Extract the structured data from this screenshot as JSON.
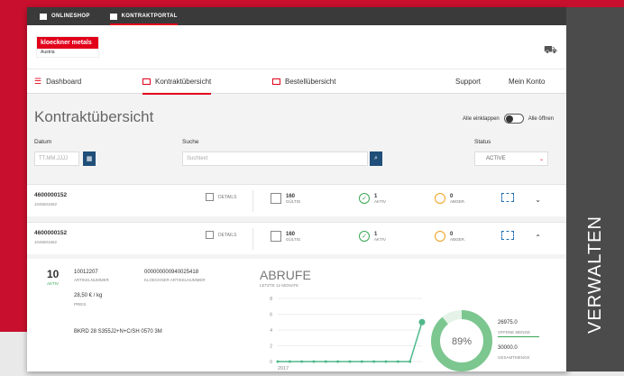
{
  "topbar": {
    "items": [
      {
        "label": "ONLINESHOP"
      },
      {
        "label": "KONTRAKTPORTAL"
      }
    ]
  },
  "header": {
    "logo_text": "kloeckner metals",
    "logo_sub": "Austria"
  },
  "nav": {
    "items": [
      {
        "label": "Dashboard"
      },
      {
        "label": "Kontraktübersicht"
      },
      {
        "label": "Bestellübersicht"
      },
      {
        "label": "Support"
      },
      {
        "label": "Mein Konto"
      }
    ]
  },
  "page": {
    "title": "Kontraktübersicht",
    "collapse_all": "Alle einklappen",
    "open_all": "Alle öffnen"
  },
  "filters": {
    "datum_label": "Datum",
    "datum_placeholder": "TT.MM.JJJJ",
    "suche_label": "Suche",
    "suche_placeholder": "Suchtext",
    "status_label": "Status",
    "status_value": "ACTIVE"
  },
  "contracts": [
    {
      "id": "4600000152",
      "sub": "1046601662",
      "details": "DETAILS",
      "gueltig_n": "160",
      "gueltig_t": "GÜLTIG",
      "aktiv_n": "1",
      "aktiv_t": "AKTIV",
      "abger_n": "0",
      "abger_t": "ABGER."
    },
    {
      "id": "4600000152",
      "sub": "1046601662",
      "details": "DETAILS",
      "gueltig_n": "160",
      "gueltig_t": "GÜLTIG",
      "aktiv_n": "1",
      "aktiv_t": "AKTIV",
      "abger_n": "0",
      "abger_t": "ABGER."
    }
  ],
  "detail": {
    "count": "10",
    "count_label": "AKTIV",
    "artikelnummer": "10012207",
    "artikelnummer_label": "ARTIKELNUMMER",
    "kloeckner_nr": "000000000940025418",
    "kloeckner_label": "KLOECKNER ARTIKELNUMMER",
    "preis": "28,50 € / kg",
    "preis_label": "PREIS",
    "description": "BKRD 28 S355J2+N+C/SH 0570 3M",
    "abrufe_title": "ABRUFE",
    "abrufe_sub": "LETZTE 12 MONATE",
    "percent": "89%",
    "offene_menge": "26975.0",
    "offene_label": "OFFENE MENGE",
    "gesamt_menge": "30000.0",
    "gesamt_label": "GESAMTMENGE"
  },
  "chart_data": {
    "type": "line",
    "x_label_visible": "2017",
    "yticks": [
      "0",
      "2",
      "4",
      "6",
      "8"
    ],
    "ylim": [
      0,
      8
    ],
    "values": [
      0,
      0,
      0,
      0,
      0,
      0,
      0,
      0,
      0,
      0,
      0,
      0,
      5
    ],
    "color": "#4fb98a"
  },
  "side": {
    "label": "VERWALTEN"
  },
  "colors": {
    "brand": "#e2001a",
    "background": "#c8102e",
    "nav_dark": "#3a3a3a",
    "button": "#1f4e79",
    "success": "#3aa655",
    "warning": "#f0a020"
  }
}
